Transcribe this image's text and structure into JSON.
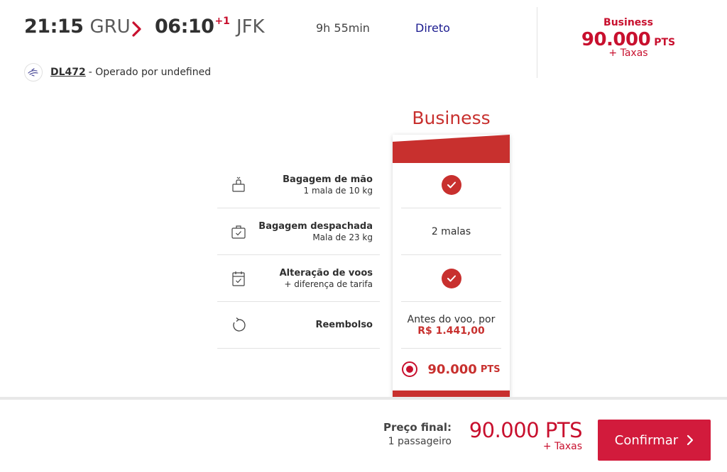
{
  "flight": {
    "departure_time": "21:15",
    "departure_airport": "GRU",
    "arrival_time": "06:10",
    "arrival_day_offset": "+1",
    "arrival_airport": "JFK",
    "duration": "9h 55min",
    "stops": "Direto",
    "flight_number": "DL472",
    "operated_by": "- Operado por undefined"
  },
  "header_price": {
    "cabin": "Business",
    "amount": "90.000",
    "unit": "PTS",
    "taxes": "+ Taxas"
  },
  "benefits": [
    {
      "icon": "carry-on-bag-icon",
      "title": "Bagagem de mão",
      "subtitle": "1 mala de 10 kg"
    },
    {
      "icon": "checked-bag-icon",
      "title": "Bagagem despachada",
      "subtitle": "Mala de 23 kg"
    },
    {
      "icon": "calendar-change-icon",
      "title": "Alteração de voos",
      "subtitle": "+ diferença de tarifa"
    },
    {
      "icon": "refund-icon",
      "title": "Reembolso",
      "subtitle": ""
    }
  ],
  "fare_column": {
    "title": "Business",
    "carry_on": "included",
    "checked_bags": "2 malas",
    "change": "included",
    "refund_text": "Antes do voo, por",
    "refund_amount": "R$ 1.441,00",
    "price_amount": "90.000",
    "price_unit": "PTS",
    "selected": true
  },
  "footer": {
    "final_label": "Preço final:",
    "passengers": "1 passageiro",
    "total": "90.000 PTS",
    "taxes": "+ Taxas",
    "confirm_label": "Confirmar"
  },
  "colors": {
    "brand_red": "#c8102e",
    "button_red": "#d21b3c",
    "direct_blue": "#1b1b8f"
  }
}
